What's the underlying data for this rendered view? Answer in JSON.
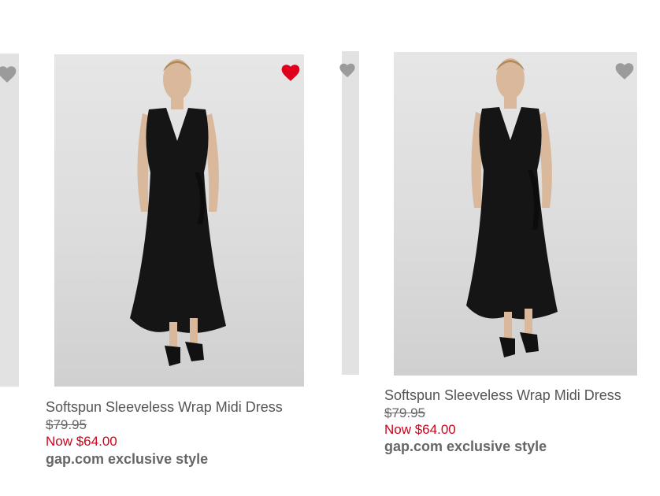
{
  "colors": {
    "sale_price": "#d0021b",
    "heart_active": "#e0001b",
    "heart_inactive": "#9b9b9b",
    "text_gray": "#555555"
  },
  "products": [
    {
      "title": "Softspun Sleeveless Wrap Midi Dress",
      "original_price": "$79.95",
      "sale_price": "Now $64.00",
      "badge": "gap.com exclusive style",
      "favorite_icon": "heart-filled-icon"
    },
    {
      "title": "Softspun Sleeveless Wrap Midi Dress",
      "original_price": "$79.95",
      "sale_price": "Now $64.00",
      "badge": "gap.com exclusive style",
      "favorite_icon": "heart-icon"
    }
  ],
  "partial_items": [
    {
      "favorite_icon": "heart-icon"
    },
    {
      "favorite_icon": "heart-icon"
    }
  ]
}
